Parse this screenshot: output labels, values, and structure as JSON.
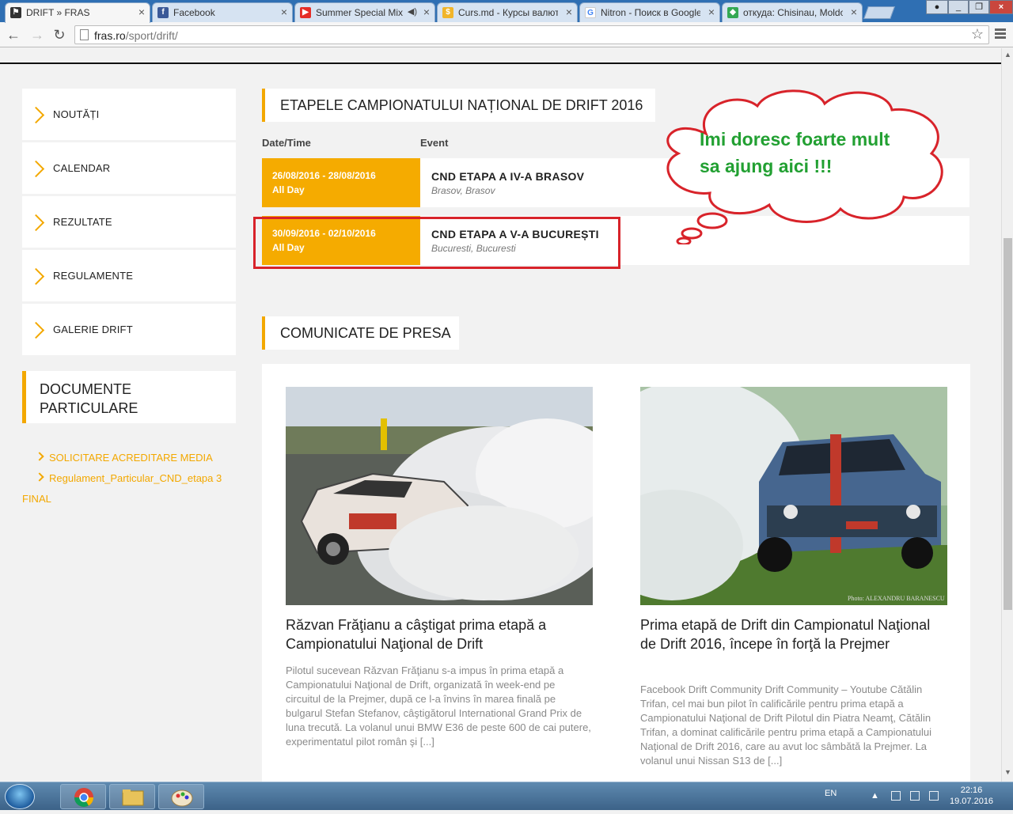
{
  "browser": {
    "tabs": [
      {
        "title": "DRIFT » FRAS",
        "active": true
      },
      {
        "title": "Facebook"
      },
      {
        "title": "Summer Special Mix"
      },
      {
        "title": "Curs.md - Курсы валют"
      },
      {
        "title": "Nitron - Поиск в Google"
      },
      {
        "title": "откуда: Chisinau, Moldova"
      }
    ],
    "url_host": "fras.ro",
    "url_path": "/sport/drift/"
  },
  "sidebar": {
    "nav": [
      "NOUTĂȚI",
      "CALENDAR",
      "REZULTATE",
      "REGULAMENTE",
      "GALERIE DRIFT"
    ],
    "documents_title": "DOCUMENTE PARTICULARE",
    "documents": [
      "SOLICITARE ACREDITARE MEDIA",
      "Regulament_Particular_CND_etapa 3",
      "FINAL"
    ]
  },
  "championship": {
    "title": "ETAPELE CAMPIONATULUI NAȚIONAL DE DRIFT 2016",
    "col_date": "Date/Time",
    "col_event": "Event",
    "events": [
      {
        "date": "26/08/2016 - 28/08/2016",
        "time": "All Day",
        "name": "CND ETAPA A IV-A BRASOV",
        "location": "Brasov, Brasov"
      },
      {
        "date": "30/09/2016 - 02/10/2016",
        "time": "All Day",
        "name": "CND ETAPA A V-A BUCUREȘTI",
        "location": "Bucuresti, Bucuresti"
      }
    ]
  },
  "annotation": {
    "line1": "Imi doresc foarte mult",
    "line2": "sa ajung aici !!!",
    "color": "#22a032",
    "outline": "#d8232a"
  },
  "press": {
    "title": "COMUNICATE DE PRESA",
    "articles": [
      {
        "title": "Răzvan Frăţianu a câştigat prima etapă a Campionatului Naţional de Drift",
        "excerpt": "Pilotul sucevean Răzvan Frăţianu s-a impus în prima etapă a Campionatului Naţional de Drift, organizată în week-end pe circuitul de la Prejmer, după ce l-a învins în marea finală pe bulgarul Stefan Stefanov, câştigătorul International Grand Prix de luna trecută. La volanul unui BMW E36 de peste 600 de cai putere, experimentatul pilot român şi [...]"
      },
      {
        "title": "Prima etapă de Drift din Campionatul Naţional de Drift 2016, începe în forţă la Prejmer",
        "excerpt": "Facebook Drift Community Drift Community – Youtube   Cătălin Trifan, cel mai bun pilot în calificările pentru prima etapă a Campionatului Naţional de Drift Pilotul din Piatra Neamţ, Cătălin Trifan, a dominat calificările pentru prima etapă a Campionatului Naţional de Drift 2016, care au avut loc sâmbătă la Prejmer. La volanul unui Nissan S13 de [...]",
        "photo_credit": "Photo: ALEXANDRU BARANESCU"
      }
    ]
  },
  "taskbar": {
    "lang": "EN",
    "time": "22:16",
    "date": "19.07.2016"
  },
  "colors": {
    "accent": "#f3a800",
    "event_date_bg": "#f5ab00"
  }
}
